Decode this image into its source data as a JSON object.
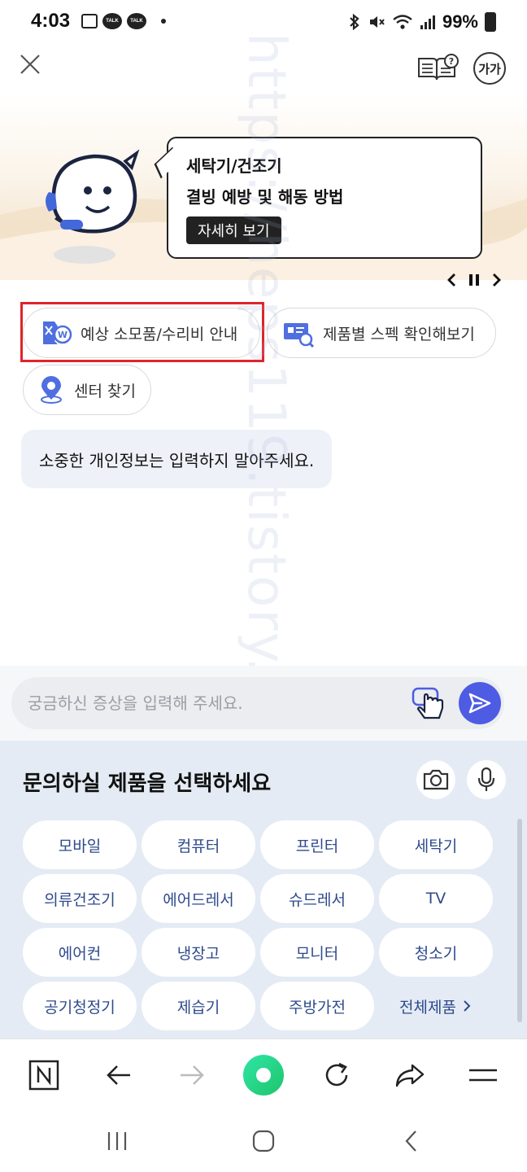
{
  "status_bar": {
    "time": "4:03",
    "talk_badge": "TALK",
    "battery": "99%"
  },
  "hero": {
    "line1": "세탁기/건조기",
    "line2": "결빙 예방 및 해동 방법",
    "more_label": "자세히 보기"
  },
  "quick_actions": [
    {
      "label": "예상 소모품/수리비 안내",
      "icon": "repair-cost-icon"
    },
    {
      "label": "제품별 스펙 확인해보기",
      "icon": "spec-search-icon"
    },
    {
      "label": "센터 찾기",
      "icon": "location-pin-icon"
    }
  ],
  "notice": "소중한 개인정보는 입력하지 말아주세요.",
  "watermark": "https://heps119.tistory.com",
  "input": {
    "placeholder": "궁금하신 증상을 입력해 주세요."
  },
  "product_panel": {
    "title": "문의하실 제품을 선택하세요",
    "products": [
      "모바일",
      "컴퓨터",
      "프린터",
      "세탁기",
      "의류건조기",
      "에어드레서",
      "슈드레서",
      "TV",
      "에어컨",
      "냉장고",
      "모니터",
      "청소기",
      "공기청정기",
      "제습기",
      "주방가전"
    ],
    "all_label": "전체제품"
  },
  "font_size_label": "가가",
  "colors": {
    "accent": "#4d5ce3",
    "highlight": "#e0242c",
    "panel_bg": "#e4ebf4",
    "product_text": "#2e4a8c"
  }
}
